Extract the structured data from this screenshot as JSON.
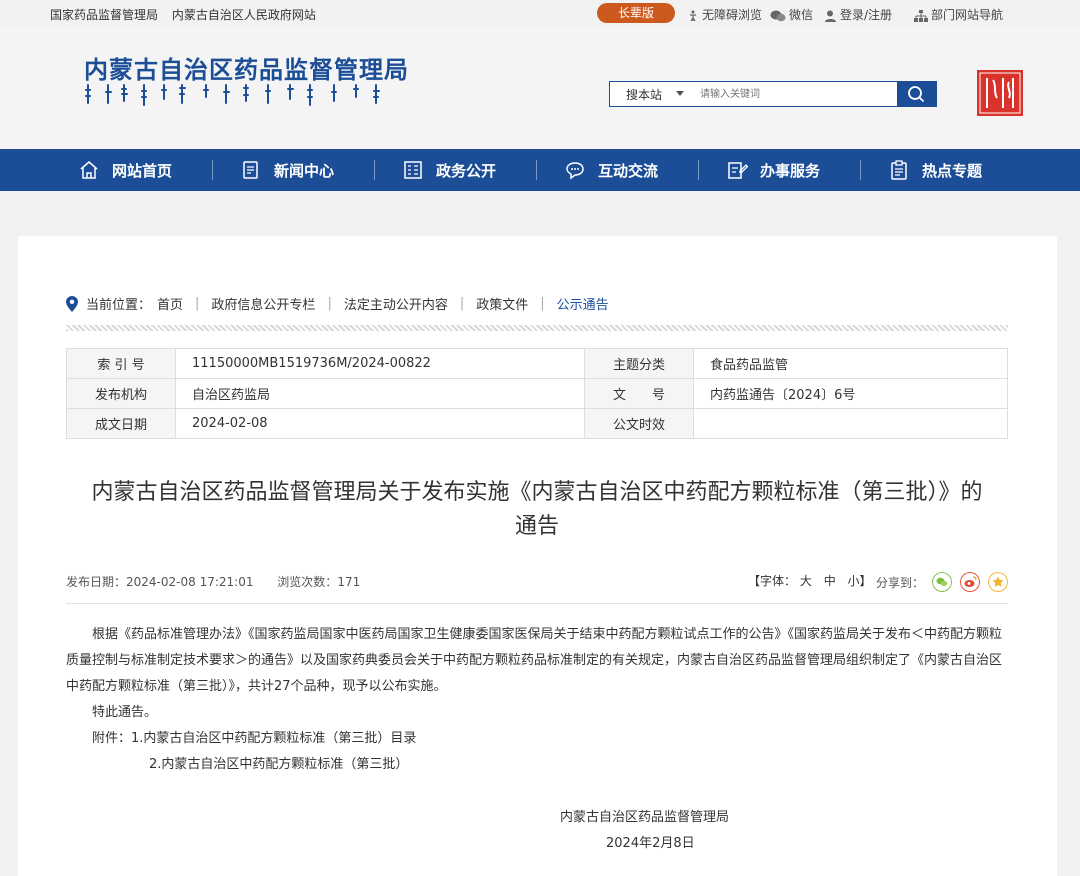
{
  "topbar": {
    "site1": "国家药品监督管理局",
    "site2": "内蒙古自治区人民政府网站",
    "elder": "长辈版",
    "accessibility": "无障碍浏览",
    "wechat": "微信",
    "login": "登录/注册",
    "dept_nav": "部门网站导航"
  },
  "header": {
    "logo": "内蒙古自治区药品监督管理局",
    "search_scope": "搜本站",
    "search_placeholder": "请输入关键词"
  },
  "nav": [
    {
      "label": "网站首页",
      "icon": "home-icon"
    },
    {
      "label": "新闻中心",
      "icon": "document-icon"
    },
    {
      "label": "政务公开",
      "icon": "building-icon"
    },
    {
      "label": "互动交流",
      "icon": "chat-icon"
    },
    {
      "label": "办事服务",
      "icon": "edit-icon"
    },
    {
      "label": "热点专题",
      "icon": "clipboard-icon"
    }
  ],
  "breadcrumb": {
    "prefix": "当前位置：",
    "items": [
      "首页",
      "政府信息公开专栏",
      "法定主动公开内容",
      "政策文件",
      "公示通告"
    ]
  },
  "meta": {
    "index_label": "索 引 号",
    "index_value": "11150000MB1519736M/2024-00822",
    "topic_label": "主题分类",
    "topic_value": "食品药品监管",
    "issuer_label": "发布机构",
    "issuer_value": "自治区药监局",
    "docno_label": "文　　号",
    "docno_value": "内药监通告〔2024〕6号",
    "date_label": "成文日期",
    "date_value": "2024-02-08",
    "validity_label": "公文时效",
    "validity_value": ""
  },
  "article": {
    "title_line1": "内蒙古自治区药品监督管理局关于发布实施《内蒙古自治区中药配方颗粒标准（第三批）》的",
    "title_line2": "通告",
    "pub_label": "发布日期：",
    "pub_date": "2024-02-08 17:21:01",
    "views_label": "浏览次数：",
    "views": "171",
    "fontsize_label": "【字体：",
    "font_big": "大",
    "font_mid": "中",
    "font_small": "小】",
    "share_label": "分享到：",
    "para1": "根据《药品标准管理办法》《国家药监局国家中医药局国家卫生健康委国家医保局关于结束中药配方颗粒试点工作的公告》《国家药监局关于发布＜中药配方颗粒质量控制与标准制定技术要求＞的通告》以及国家药典委员会关于中药配方颗粒药品标准制定的有关规定，内蒙古自治区药品监督管理局组织制定了《内蒙古自治区中药配方颗粒标准（第三批）》，共计27个品种，现予以公布实施。",
    "para2": "特此通告。",
    "attach1": "附件：1.内蒙古自治区中药配方颗粒标准（第三批）目录",
    "attach2": "2.内蒙古自治区中药配方颗粒标准（第三批）",
    "sign_org": "内蒙古自治区药品监督管理局",
    "sign_date": "2024年2月8日"
  },
  "colors": {
    "brand": "#1b4e97",
    "elder": "#cc5a1f",
    "seal": "#d9332b"
  }
}
